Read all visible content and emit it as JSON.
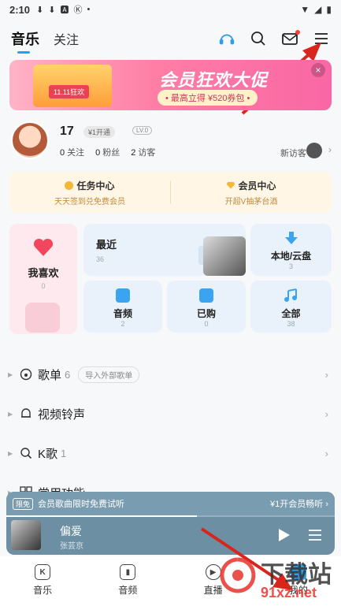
{
  "status_bar": {
    "time": "2:10",
    "icons": [
      "download-icon",
      "download-icon",
      "a-icon",
      "k-icon",
      "dot-icon"
    ],
    "right_icons": [
      "wifi-icon",
      "signal-icon",
      "battery-icon"
    ]
  },
  "header": {
    "tab_music": "音乐",
    "tab_follow": "关注",
    "icons": [
      "listen-recognize-icon",
      "search-icon",
      "mail-icon",
      "menu-icon"
    ]
  },
  "banner": {
    "title": "会员狂欢大促",
    "subtitle": "• 最高立得 ¥520券包 •",
    "gift_tag": "11.11狂欢",
    "close": "×"
  },
  "profile": {
    "name": "17",
    "vip_badge": "¥1开通",
    "level": "LV.0",
    "following_count": "0",
    "following_label": "关注",
    "fans_count": "0",
    "fans_label": "粉丝",
    "visitors_count": "2",
    "visitors_label": "访客",
    "new_visitor": "新访客"
  },
  "centers": [
    {
      "title": "任务中心",
      "sub": "天天签到兑免费会员"
    },
    {
      "title": "会员中心",
      "sub": "开超V抽茅台酒"
    }
  ],
  "grid": {
    "favorite": {
      "label": "我喜欢",
      "count": "0"
    },
    "recent": {
      "label": "最近",
      "count": "36"
    },
    "local": {
      "label": "本地/云盘",
      "count": "3"
    },
    "audio": {
      "label": "音频",
      "count": "2"
    },
    "purchased": {
      "label": "已购",
      "count": "0"
    },
    "all": {
      "label": "全部",
      "count": "38"
    }
  },
  "list": {
    "playlist": {
      "label": "歌单",
      "count": "6",
      "import": "导入外部歌单"
    },
    "video_ringtone": {
      "label": "视频铃声"
    },
    "karaoke": {
      "label": "K歌",
      "count": "1"
    },
    "common": {
      "label": "常用功能"
    }
  },
  "player": {
    "promo_tag": "限免",
    "promo_text": "会员歌曲限时免费试听",
    "promo_right": "¥1开会员畅听 ›",
    "song": "偏爱",
    "artist": "张芸京",
    "progress": 0.58
  },
  "bottom_nav": [
    {
      "label": "音乐",
      "icon": "K"
    },
    {
      "label": "音频",
      "icon": ""
    },
    {
      "label": "直播",
      "icon": ""
    },
    {
      "label": "我的",
      "icon": ""
    }
  ],
  "watermark": {
    "text": "下载站",
    "url": "91xz.net"
  }
}
